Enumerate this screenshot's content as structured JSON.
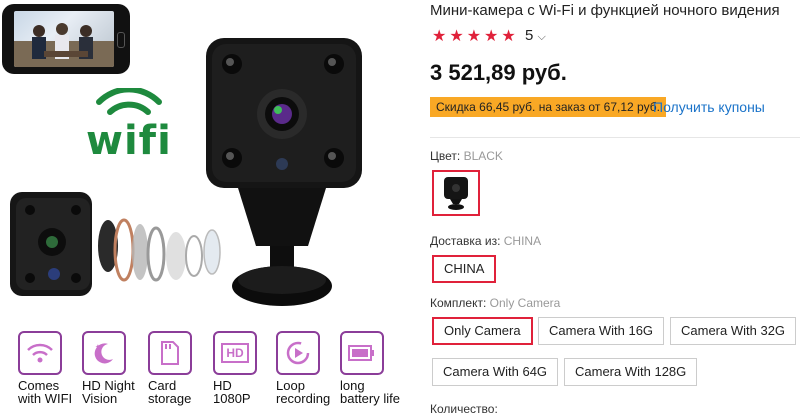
{
  "left": {
    "wifi_logo_text": "wifi",
    "features": [
      {
        "icon": "wifi-icon",
        "line1": "Comes",
        "line2": "with WIFI"
      },
      {
        "icon": "night-moon-icon",
        "line1": "HD Night",
        "line2": "Vision"
      },
      {
        "icon": "sd-card-icon",
        "line1": "Card",
        "line2": "storage"
      },
      {
        "icon": "hd-icon",
        "line1": "HD",
        "line2": "1080P",
        "icon_text": "HD"
      },
      {
        "icon": "replay-icon",
        "line1": "Loop",
        "line2": "recording"
      },
      {
        "icon": "battery-icon",
        "line1": "long",
        "line2": "battery life"
      }
    ]
  },
  "product": {
    "title": "Мини-камера с Wi-Fi и функцией ночного видения",
    "rating": "5",
    "star_color": "#e0213a",
    "price": "3 521,89 руб.",
    "discount": "Скидка 66,45 руб. на заказ от 67,12 руб.",
    "coupons_link": "Получить купоны",
    "color": {
      "label": "Цвет:",
      "value": "BLACK"
    },
    "shipping": {
      "label": "Доставка из:",
      "value": "CHINA",
      "options": [
        "CHINA"
      ]
    },
    "bundle": {
      "label": "Комплект:",
      "value": "Only Camera",
      "options": [
        "Only Camera",
        "Camera With 16G",
        "Camera With 32G",
        "Camera With 64G",
        "Camera With 128G"
      ]
    },
    "quantity_label": "Количество:"
  },
  "colors": {
    "accent": "#e0213a",
    "discount_bg": "#f9a825",
    "link": "#1a73c9",
    "feature_border": "#8b3d99",
    "wifi_green": "#1e8a3e"
  }
}
